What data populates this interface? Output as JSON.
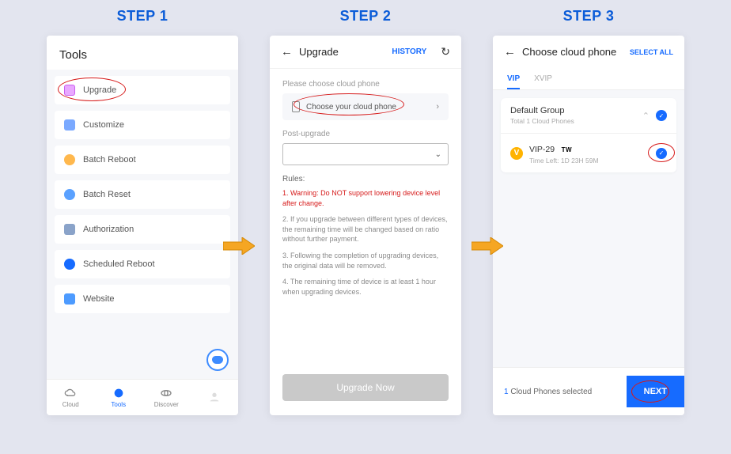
{
  "steps": {
    "s1": {
      "label": "STEP 1"
    },
    "s2": {
      "label": "STEP 2"
    },
    "s3": {
      "label": "STEP 3"
    }
  },
  "step1": {
    "title": "Tools",
    "items": [
      {
        "label": "Upgrade"
      },
      {
        "label": "Customize"
      },
      {
        "label": "Batch Reboot"
      },
      {
        "label": "Batch Reset"
      },
      {
        "label": "Authorization"
      },
      {
        "label": "Scheduled Reboot"
      },
      {
        "label": "Website"
      }
    ],
    "nav": {
      "cloud": "Cloud",
      "tools": "Tools",
      "discover": "Discover",
      "me": " "
    }
  },
  "step2": {
    "title": "Upgrade",
    "history": "HISTORY",
    "section_choose": "Please choose cloud phone",
    "choose_label": "Choose your cloud phone",
    "section_post": "Post-upgrade",
    "rules_title": "Rules:",
    "rule1": "1. Warning: Do NOT support lowering device level after change.",
    "rule2": "2. If you upgrade between different types of devices, the remaining time will be changed based on ratio without further payment.",
    "rule3": "3. Following the completion of upgrading devices, the original data will be removed.",
    "rule4": "4. The remaining time of device is at least 1 hour when upgrading devices.",
    "button": "Upgrade Now"
  },
  "step3": {
    "title": "Choose cloud phone",
    "select_all": "SELECT ALL",
    "tab_vip": "VIP",
    "tab_xvip": "XVIP",
    "group_name": "Default Group",
    "group_sub": "Total 1 Cloud Phones",
    "device_name": "VIP-29",
    "device_flag": "TW",
    "device_sub": "Time Left:  1D  23H  59M",
    "selected_count": "1",
    "selected_suffix": " Cloud Phones selected",
    "next": "NEXT"
  }
}
